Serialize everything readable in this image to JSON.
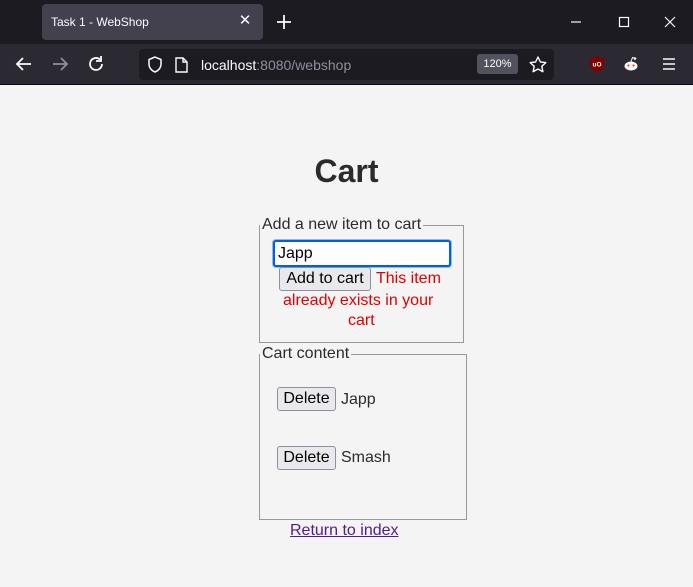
{
  "browser": {
    "tab_title": "Task 1 - WebShop",
    "url_host": "localhost",
    "url_path": ":8080/webshop",
    "zoom": "120%"
  },
  "page": {
    "title": "Cart",
    "add_section": {
      "legend": "Add a new item to cart",
      "input_value": "Japp",
      "button_label": "Add to cart",
      "error_lines": [
        "This item",
        "already exists in your",
        "cart"
      ]
    },
    "cart_section": {
      "legend": "Cart content",
      "delete_label": "Delete",
      "items": [
        {
          "name": "Japp"
        },
        {
          "name": "Smash"
        }
      ]
    },
    "return_link": "Return to index"
  },
  "colors": {
    "error": "#e00000",
    "visited_link": "#551a8b",
    "focus": "#0060df"
  }
}
